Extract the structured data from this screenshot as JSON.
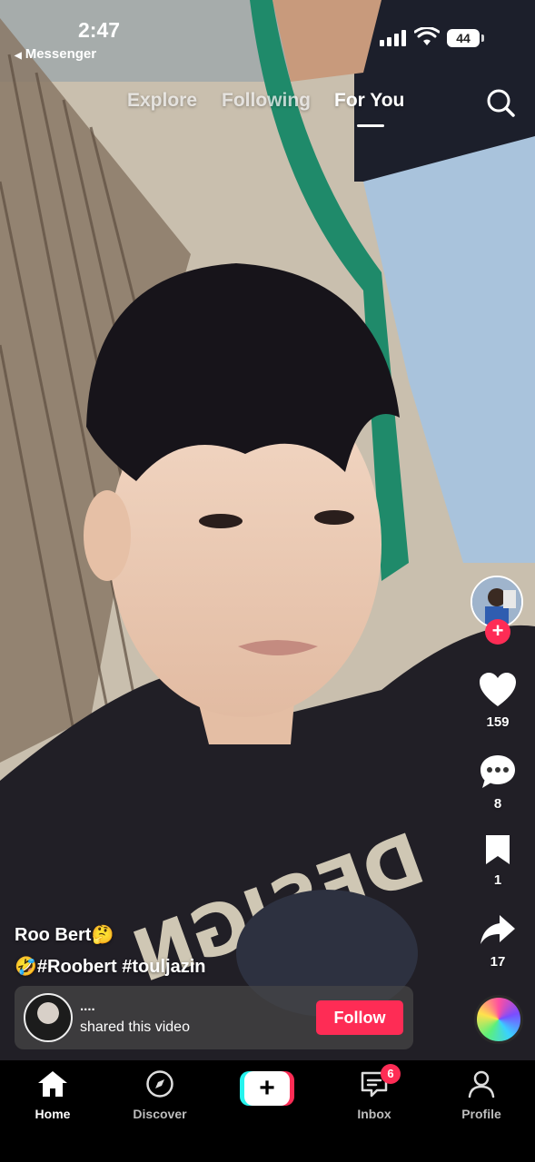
{
  "status_bar": {
    "time": "2:47",
    "back_label": "Messenger",
    "battery": "44"
  },
  "top_nav": {
    "tabs": [
      {
        "label": "Explore"
      },
      {
        "label": "Following"
      },
      {
        "label": "For You",
        "active": true
      }
    ]
  },
  "actions": {
    "likes": "159",
    "comments": "8",
    "saves": "1",
    "shares": "17"
  },
  "caption": {
    "username": "Roo Bert",
    "username_emoji": "🤔",
    "lead_emoji": "🤣",
    "hashtags": [
      "#Roobert",
      "#touljazin"
    ]
  },
  "shared_card": {
    "name": "....",
    "text": "shared this video",
    "follow_label": "Follow"
  },
  "bottom_nav": {
    "items": [
      {
        "label": "Home",
        "icon": "home-icon",
        "active": true
      },
      {
        "label": "Discover",
        "icon": "compass-icon"
      },
      {
        "label": "Inbox",
        "icon": "inbox-icon",
        "badge": "6"
      },
      {
        "label": "Profile",
        "icon": "profile-icon"
      }
    ]
  },
  "colors": {
    "accent": "#fe2c55",
    "cyan": "#25f4ee"
  }
}
